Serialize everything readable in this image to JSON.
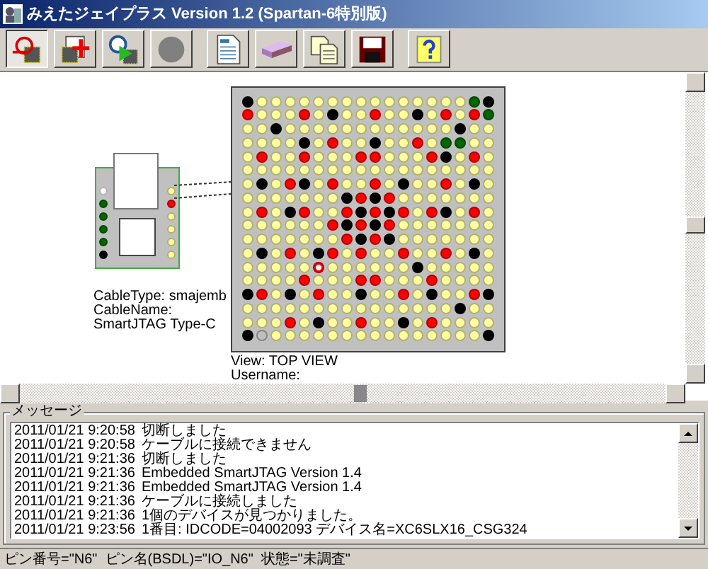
{
  "window": {
    "title": "みえたジェイプラス Version 1.2 (Spartan-6特別版)"
  },
  "toolbar": [
    {
      "buttons": [
        {
          "kind": "chip-plug",
          "pressed": true
        },
        {
          "kind": "chip-plus",
          "pressed": false
        },
        {
          "kind": "magnifier-play",
          "pressed": false
        },
        {
          "kind": "circle",
          "pressed": false
        }
      ]
    },
    {
      "buttons": [
        {
          "kind": "document",
          "pressed": false
        },
        {
          "kind": "device",
          "pressed": false
        },
        {
          "kind": "documents",
          "pressed": false
        },
        {
          "kind": "floppy",
          "pressed": false
        }
      ]
    },
    {
      "buttons": [
        {
          "kind": "help",
          "pressed": false
        }
      ]
    }
  ],
  "cable": {
    "left_pins": [
      {
        "color": "#ffffff"
      },
      {
        "color": "#006600"
      },
      {
        "color": "#006600"
      },
      {
        "color": "#006600"
      },
      {
        "color": "#006600"
      },
      {
        "color": "#000000"
      }
    ],
    "right_pins": [
      {
        "color": "#ffffa0"
      },
      {
        "color": "#ff0000"
      },
      {
        "color": "#ffffa0"
      },
      {
        "color": "#ffffa0"
      },
      {
        "color": "#ffffa0"
      },
      {
        "color": "#ffffa0"
      }
    ],
    "info": [
      "CableType: smajemb",
      "CableName:",
      "SmartJTAG Type-C"
    ]
  },
  "pin_grid": {
    "rows": [
      [
        {
          "color": "#000000"
        },
        {
          "color": "#ffffa0"
        },
        {
          "color": "#ffffa0"
        },
        {
          "color": "#ffffa0"
        },
        {
          "color": "#ffffa0"
        },
        {
          "color": "#ffffa0"
        },
        {
          "color": "#ffffa0"
        },
        {
          "color": "#ffffa0"
        },
        {
          "color": "#ffffa0"
        },
        {
          "color": "#ffffa0"
        },
        {
          "color": "#ffffa0"
        },
        {
          "color": "#ffffa0"
        },
        {
          "color": "#ffffa0"
        },
        {
          "color": "#ffffa0"
        },
        {
          "color": "#ffffa0"
        },
        {
          "color": "#ffffa0"
        },
        {
          "color": "#006600"
        },
        {
          "color": "#000000"
        }
      ],
      [
        {
          "color": "#ff0000"
        },
        {
          "color": "#ffffa0"
        },
        {
          "color": "#ffffa0"
        },
        {
          "color": "#ffffa0"
        },
        {
          "color": "#ff0000"
        },
        {
          "color": "#ffffa0"
        },
        {
          "color": "#000000"
        },
        {
          "color": "#ffffa0"
        },
        {
          "color": "#ffffa0"
        },
        {
          "color": "#ff0000"
        },
        {
          "color": "#ffffa0"
        },
        {
          "color": "#ffffa0"
        },
        {
          "color": "#000000"
        },
        {
          "color": "#ffffa0"
        },
        {
          "color": "#ff0000"
        },
        {
          "color": "#ffffa0"
        },
        {
          "color": "#ff0000"
        },
        {
          "color": "#006600"
        }
      ],
      [
        {
          "color": "#ffffa0"
        },
        {
          "color": "#ffffa0"
        },
        {
          "color": "#000000"
        },
        {
          "color": "#ffffa0"
        },
        {
          "color": "#ffffa0"
        },
        {
          "color": "#ffffa0"
        },
        {
          "color": "#ffffa0"
        },
        {
          "color": "#ffffa0"
        },
        {
          "color": "#ffffa0"
        },
        {
          "color": "#ffffa0"
        },
        {
          "color": "#ffffa0"
        },
        {
          "color": "#ffffa0"
        },
        {
          "color": "#ffffa0"
        },
        {
          "color": "#ffffa0"
        },
        {
          "color": "#ffffa0"
        },
        {
          "color": "#000000"
        },
        {
          "color": "#ffffa0"
        },
        {
          "color": "#ffffa0"
        }
      ],
      [
        {
          "color": "#ffffa0"
        },
        {
          "color": "#ffffa0"
        },
        {
          "color": "#ffffa0"
        },
        {
          "color": "#ffffa0"
        },
        {
          "color": "#000000"
        },
        {
          "color": "#ffffa0"
        },
        {
          "color": "#ff0000"
        },
        {
          "color": "#ffffa0"
        },
        {
          "color": "#ffffa0"
        },
        {
          "color": "#000000"
        },
        {
          "color": "#ffffa0"
        },
        {
          "color": "#ffffa0"
        },
        {
          "color": "#ff0000"
        },
        {
          "color": "#ffffa0"
        },
        {
          "color": "#006600"
        },
        {
          "color": "#006600"
        },
        {
          "color": "#ffffa0"
        },
        {
          "color": "#ffffa0"
        }
      ],
      [
        {
          "color": "#ffffa0"
        },
        {
          "color": "#ff0000"
        },
        {
          "color": "#ffffa0"
        },
        {
          "color": "#ffffa0"
        },
        {
          "color": "#ff0000"
        },
        {
          "color": "#ffffa0"
        },
        {
          "color": "#ffffa0"
        },
        {
          "color": "#ffffa0"
        },
        {
          "color": "#ff0000"
        },
        {
          "color": "#ff0000"
        },
        {
          "color": "#ffffa0"
        },
        {
          "color": "#ffffa0"
        },
        {
          "color": "#ffffa0"
        },
        {
          "color": "#ff0000"
        },
        {
          "color": "#000000"
        },
        {
          "color": "#ffffa0"
        },
        {
          "color": "#ff0000"
        },
        {
          "color": "#ffffa0"
        }
      ],
      [
        {
          "color": "#ffffa0"
        },
        {
          "color": "#ffffa0"
        },
        {
          "color": "#ffffa0"
        },
        {
          "color": "#ffffa0"
        },
        {
          "color": "#ffffa0"
        },
        {
          "color": "#ffffa0"
        },
        {
          "color": "#ffffa0"
        },
        {
          "color": "#ffffa0"
        },
        {
          "color": "#ffffa0"
        },
        {
          "color": "#ffffa0"
        },
        {
          "color": "#ffffa0"
        },
        {
          "color": "#ffffa0"
        },
        {
          "color": "#ffffa0"
        },
        {
          "color": "#ffffa0"
        },
        {
          "color": "#ffffa0"
        },
        {
          "color": "#ffffa0"
        },
        {
          "color": "#ffffa0"
        },
        {
          "color": "#ffffa0"
        }
      ],
      [
        {
          "color": "#ffffa0"
        },
        {
          "color": "#000000"
        },
        {
          "color": "#ffffa0"
        },
        {
          "color": "#ff0000"
        },
        {
          "color": "#000000"
        },
        {
          "color": "#ffffa0"
        },
        {
          "color": "#ff0000"
        },
        {
          "color": "#ffffa0"
        },
        {
          "color": "#ffffa0"
        },
        {
          "color": "#ff0000"
        },
        {
          "color": "#ffffa0"
        },
        {
          "color": "#000000"
        },
        {
          "color": "#ffffa0"
        },
        {
          "color": "#ffffa0"
        },
        {
          "color": "#ff0000"
        },
        {
          "color": "#ffffa0"
        },
        {
          "color": "#000000"
        },
        {
          "color": "#ffffa0"
        }
      ],
      [
        {
          "color": "#ffffa0"
        },
        {
          "color": "#ffffa0"
        },
        {
          "color": "#ffffa0"
        },
        {
          "color": "#ffffa0"
        },
        {
          "color": "#ffffa0"
        },
        {
          "color": "#ffffa0"
        },
        {
          "color": "#ffffa0"
        },
        {
          "color": "#000000"
        },
        {
          "color": "#ff0000"
        },
        {
          "color": "#000000"
        },
        {
          "color": "#ff0000"
        },
        {
          "color": "#ffffa0"
        },
        {
          "color": "#ffffa0"
        },
        {
          "color": "#ffffa0"
        },
        {
          "color": "#ffffa0"
        },
        {
          "color": "#ffffa0"
        },
        {
          "color": "#ffffa0"
        },
        {
          "color": "#ffffa0"
        }
      ],
      [
        {
          "color": "#ffffa0"
        },
        {
          "color": "#ff0000"
        },
        {
          "color": "#ffffa0"
        },
        {
          "color": "#000000"
        },
        {
          "color": "#ff0000"
        },
        {
          "color": "#ffffa0"
        },
        {
          "color": "#ffffa0"
        },
        {
          "color": "#ff0000"
        },
        {
          "color": "#000000"
        },
        {
          "color": "#ff0000"
        },
        {
          "color": "#000000"
        },
        {
          "color": "#ff0000"
        },
        {
          "color": "#ffffa0"
        },
        {
          "color": "#ff0000"
        },
        {
          "color": "#000000"
        },
        {
          "color": "#ffffa0"
        },
        {
          "color": "#ff0000"
        },
        {
          "color": "#ffffa0"
        }
      ],
      [
        {
          "color": "#ffffa0"
        },
        {
          "color": "#ffffa0"
        },
        {
          "color": "#ffffa0"
        },
        {
          "color": "#ffffa0"
        },
        {
          "color": "#ffffa0"
        },
        {
          "color": "#ffffa0"
        },
        {
          "color": "#ff0000"
        },
        {
          "color": "#000000"
        },
        {
          "color": "#ff0000"
        },
        {
          "color": "#000000"
        },
        {
          "color": "#ff0000"
        },
        {
          "color": "#ffffa0"
        },
        {
          "color": "#ffffa0"
        },
        {
          "color": "#ffffa0"
        },
        {
          "color": "#ffffa0"
        },
        {
          "color": "#ffffa0"
        },
        {
          "color": "#ffffa0"
        },
        {
          "color": "#ffffa0"
        }
      ],
      [
        {
          "color": "#ffffa0"
        },
        {
          "color": "#ffffa0"
        },
        {
          "color": "#ffffa0"
        },
        {
          "color": "#ffffa0"
        },
        {
          "color": "#ffffa0"
        },
        {
          "color": "#ffffa0"
        },
        {
          "color": "#ffffa0"
        },
        {
          "color": "#ff0000"
        },
        {
          "color": "#000000"
        },
        {
          "color": "#ff0000"
        },
        {
          "color": "#000000"
        },
        {
          "color": "#ffffa0"
        },
        {
          "color": "#ffffa0"
        },
        {
          "color": "#ffffa0"
        },
        {
          "color": "#ffffa0"
        },
        {
          "color": "#ffffa0"
        },
        {
          "color": "#ffffa0"
        },
        {
          "color": "#ffffa0"
        }
      ],
      [
        {
          "color": "#ffffa0"
        },
        {
          "color": "#000000"
        },
        {
          "color": "#ffffa0"
        },
        {
          "color": "#ff0000"
        },
        {
          "color": "#ffffa0"
        },
        {
          "color": "#000000"
        },
        {
          "color": "#ff0000"
        },
        {
          "color": "#ffffa0"
        },
        {
          "color": "#ff0000"
        },
        {
          "color": "#ffffa0"
        },
        {
          "color": "#ffffa0"
        },
        {
          "color": "#ff0000"
        },
        {
          "color": "#ffffa0"
        },
        {
          "color": "#ffffa0"
        },
        {
          "color": "#ff0000"
        },
        {
          "color": "#ffffa0"
        },
        {
          "color": "#000000"
        },
        {
          "color": "#ffffa0"
        }
      ],
      [
        {
          "color": "#ffffa0"
        },
        {
          "color": "#ffffa0"
        },
        {
          "color": "#ffffa0"
        },
        {
          "color": "#ffffa0"
        },
        {
          "color": "#ffffa0"
        },
        {
          "color": "#ff0000",
          "selected": true
        },
        {
          "color": "#ffffa0"
        },
        {
          "color": "#ffffa0"
        },
        {
          "color": "#ffffa0"
        },
        {
          "color": "#ffffa0"
        },
        {
          "color": "#ffffa0"
        },
        {
          "color": "#ffffa0"
        },
        {
          "color": "#000000"
        },
        {
          "color": "#ffffa0"
        },
        {
          "color": "#ffffa0"
        },
        {
          "color": "#ffffa0"
        },
        {
          "color": "#ffffa0"
        },
        {
          "color": "#ffffa0"
        }
      ],
      [
        {
          "color": "#ffffa0"
        },
        {
          "color": "#ffffa0"
        },
        {
          "color": "#ffffa0"
        },
        {
          "color": "#ffffa0"
        },
        {
          "color": "#ff0000"
        },
        {
          "color": "#ffffa0"
        },
        {
          "color": "#ffffa0"
        },
        {
          "color": "#ffffa0"
        },
        {
          "color": "#ff0000"
        },
        {
          "color": "#ff0000"
        },
        {
          "color": "#ffffa0"
        },
        {
          "color": "#ffffa0"
        },
        {
          "color": "#ffffa0"
        },
        {
          "color": "#ff0000"
        },
        {
          "color": "#ffffa0"
        },
        {
          "color": "#ffffa0"
        },
        {
          "color": "#ffffa0"
        },
        {
          "color": "#ffffa0"
        }
      ],
      [
        {
          "color": "#000000"
        },
        {
          "color": "#ff0000"
        },
        {
          "color": "#ffffa0"
        },
        {
          "color": "#000000"
        },
        {
          "color": "#ffffa0"
        },
        {
          "color": "#ff0000"
        },
        {
          "color": "#ffffa0"
        },
        {
          "color": "#ffffa0"
        },
        {
          "color": "#000000"
        },
        {
          "color": "#ffffa0"
        },
        {
          "color": "#ffffa0"
        },
        {
          "color": "#ff0000"
        },
        {
          "color": "#ffffa0"
        },
        {
          "color": "#000000"
        },
        {
          "color": "#ffffa0"
        },
        {
          "color": "#ffffa0"
        },
        {
          "color": "#ff0000"
        },
        {
          "color": "#000000"
        }
      ],
      [
        {
          "color": "#ffffa0"
        },
        {
          "color": "#ffffa0"
        },
        {
          "color": "#ffffa0"
        },
        {
          "color": "#ffffa0"
        },
        {
          "color": "#ffffa0"
        },
        {
          "color": "#ffffa0"
        },
        {
          "color": "#ffffa0"
        },
        {
          "color": "#ffffa0"
        },
        {
          "color": "#ffffa0"
        },
        {
          "color": "#ffffa0"
        },
        {
          "color": "#ffffa0"
        },
        {
          "color": "#ffffa0"
        },
        {
          "color": "#ffffa0"
        },
        {
          "color": "#ffffa0"
        },
        {
          "color": "#ffffa0"
        },
        {
          "color": "#000000"
        },
        {
          "color": "#ffffa0"
        },
        {
          "color": "#ffffa0"
        }
      ],
      [
        {
          "color": "#ffffa0"
        },
        {
          "color": "#ffffa0"
        },
        {
          "color": "#ffffa0"
        },
        {
          "color": "#ff0000"
        },
        {
          "color": "#ffffa0"
        },
        {
          "color": "#000000"
        },
        {
          "color": "#ffffa0"
        },
        {
          "color": "#ffffa0"
        },
        {
          "color": "#ff0000"
        },
        {
          "color": "#ffffa0"
        },
        {
          "color": "#ffffa0"
        },
        {
          "color": "#000000"
        },
        {
          "color": "#ffffa0"
        },
        {
          "color": "#ff0000"
        },
        {
          "color": "#ffffa0"
        },
        {
          "color": "#ffffa0"
        },
        {
          "color": "#ffffa0"
        },
        {
          "color": "#ffffa0"
        }
      ],
      [
        {
          "color": "#000000"
        },
        {
          "color": "#c0c0c0"
        },
        {
          "color": "#ffffa0"
        },
        {
          "color": "#ffffa0"
        },
        {
          "color": "#ffffa0"
        },
        {
          "color": "#ffffa0"
        },
        {
          "color": "#ffffa0"
        },
        {
          "color": "#ffffa0"
        },
        {
          "color": "#ffffa0"
        },
        {
          "color": "#ffffa0"
        },
        {
          "color": "#ffffa0"
        },
        {
          "color": "#ffffa0"
        },
        {
          "color": "#ffffa0"
        },
        {
          "color": "#ffffa0"
        },
        {
          "color": "#ffffa0"
        },
        {
          "color": "#ffffa0"
        },
        {
          "color": "#ffffa0"
        },
        {
          "color": "#000000"
        }
      ]
    ]
  },
  "view_info": [
    "View: TOP VIEW",
    "Username:"
  ],
  "messages": {
    "title": "メッセージ",
    "lines": [
      {
        "time": "2011/01/21 9:20:58",
        "text": "切断しました"
      },
      {
        "time": "2011/01/21 9:20:58",
        "text": "ケーブルに接続できません"
      },
      {
        "time": "2011/01/21 9:21:36",
        "text": "切断しました"
      },
      {
        "time": "2011/01/21 9:21:36",
        "text": "Embedded SmartJTAG Version 1.4"
      },
      {
        "time": "2011/01/21 9:21:36",
        "text": "Embedded SmartJTAG Version 1.4"
      },
      {
        "time": "2011/01/21 9:21:36",
        "text": "ケーブルに接続しました"
      },
      {
        "time": "2011/01/21 9:21:36",
        "text": "1個のデバイスが見つかりました。"
      },
      {
        "time": "2011/01/21 9:23:56",
        "text": "1番目: IDCODE=04002093 デバイス名=XC6SLX16_CSG324"
      }
    ]
  },
  "status_bar": "ピン番号=\"N6\"  ピン名(BSDL)=\"IO_N6\"  状態=\"未調査\""
}
